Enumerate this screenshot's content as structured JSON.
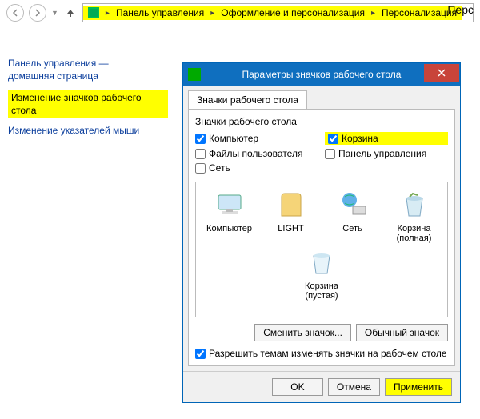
{
  "toptitle": "Перс",
  "breadcrumb": {
    "items": [
      "Панель управления",
      "Оформление и персонализация",
      "Персонализация"
    ]
  },
  "sidebar": {
    "home1": "Панель управления —",
    "home2": "домашняя страница",
    "change_icons1": "Изменение значков рабочего",
    "change_icons2": "стола",
    "change_pointers": "Изменение указателей мыши"
  },
  "dialog": {
    "title": "Параметры значков рабочего стола",
    "tab": "Значки рабочего стола",
    "group_label": "Значки рабочего стола",
    "checks": {
      "computer": "Компьютер",
      "recycle": "Корзина",
      "userfiles": "Файлы пользователя",
      "cpanel": "Панель управления",
      "network": "Сеть"
    },
    "icons": {
      "computer": "Компьютер",
      "light": "LIGHT",
      "network": "Сеть",
      "bin_full1": "Корзина",
      "bin_full2": "(полная)",
      "bin_empty1": "Корзина",
      "bin_empty2": "(пустая)"
    },
    "buttons": {
      "change": "Сменить значок...",
      "default": "Обычный значок"
    },
    "allow": "Разрешить темам изменять значки на рабочем столе",
    "footer": {
      "ok": "OK",
      "cancel": "Отмена",
      "apply": "Применить"
    }
  }
}
